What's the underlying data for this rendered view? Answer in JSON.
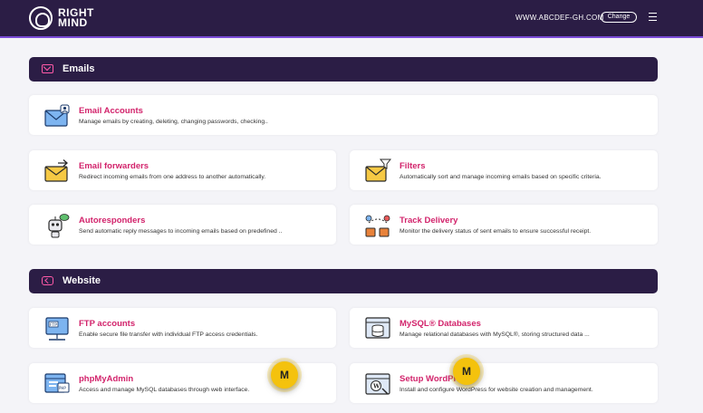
{
  "header": {
    "logo_line1": "RIGHT",
    "logo_line2": "MIND",
    "domain": "WWW.ABCDEF-GH.COM",
    "change_label": "Change"
  },
  "sections": {
    "emails": {
      "title": "Emails",
      "cards": {
        "email_accounts": {
          "title": "Email Accounts",
          "desc": "Manage emails by creating, deleting, changing passwords, checking.."
        },
        "email_forwarders": {
          "title": "Email forwarders",
          "desc": "Redirect incoming emails from one address to another automatically."
        },
        "filters": {
          "title": "Filters",
          "desc": "Automatically sort and manage incoming emails based on specific criteria."
        },
        "autoresponders": {
          "title": "Autoresponders",
          "desc": "Send automatic reply messages to incoming emails based on predefined .."
        },
        "track_delivery": {
          "title": "Track Delivery",
          "desc": "Monitor the delivery status of sent emails to ensure successful receipt."
        }
      }
    },
    "website": {
      "title": "Website",
      "cards": {
        "ftp_accounts": {
          "title": "FTP accounts",
          "desc": "Enable secure file transfer with individual FTP access credentials."
        },
        "mysql_databases": {
          "title": "MySQL® Databases",
          "desc": "Manage relational databases with MySQL®, storing structured data ..."
        },
        "phpmyadmin": {
          "title": "phpMyAdmin",
          "desc": "Access and manage MySQL databases through web interface."
        },
        "setup_wordpress": {
          "title": "Setup WordPress",
          "desc": "Install and configure WordPress for website creation and management."
        }
      }
    }
  },
  "badges": {
    "label": "M"
  }
}
